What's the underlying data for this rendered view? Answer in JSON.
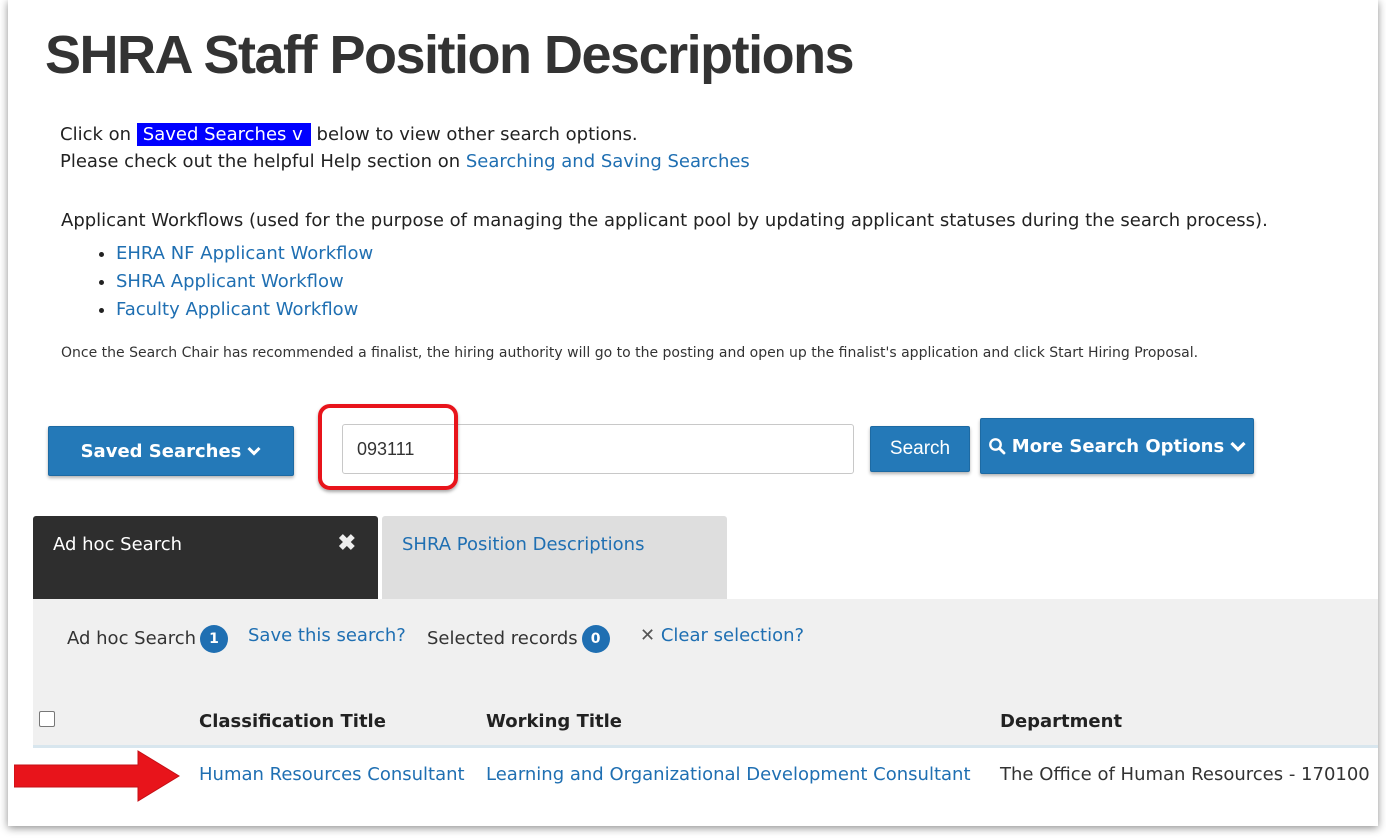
{
  "page_title": "SHRA Staff Position Descriptions",
  "instructions": {
    "click_on": "Click on",
    "saved_searches_highlight": "Saved Searches v",
    "below_text": "below to view other search options.",
    "help_text": "Please check out the helpful Help section on",
    "help_link": "Searching and Saving Searches"
  },
  "workflows": {
    "intro": "Applicant Workflows (used for the purpose of managing the applicant pool by updating applicant statuses during the search process).",
    "items": [
      "EHRA NF Applicant Workflow",
      "SHRA Applicant Workflow",
      "Faculty Applicant Workflow"
    ]
  },
  "note": "Once the Search Chair has recommended a finalist, the hiring authority will go to the posting and open up the finalist's application and click Start Hiring Proposal.",
  "search_bar": {
    "saved_searches_button": "Saved Searches",
    "query_value": "093111",
    "search_button": "Search",
    "more_options_button": "More Search Options"
  },
  "tabs": [
    {
      "label": "Ad hoc Search",
      "active": true
    },
    {
      "label": "SHRA Position Descriptions",
      "active": false
    }
  ],
  "toolbar": {
    "adhoc_label": "Ad hoc Search",
    "adhoc_count": "1",
    "save_link": "Save this search?",
    "selected_label": "Selected records",
    "selected_count": "0",
    "clear_link": "Clear selection?"
  },
  "table": {
    "columns": [
      "Classification Title",
      "Working Title",
      "Department"
    ],
    "rows": [
      [
        "Human Resources Consultant",
        "Learning and Organizational Development Consultant",
        "The Office of Human Resources - 170100"
      ]
    ]
  },
  "colors": {
    "button_blue": "#2479b8",
    "link_blue": "#1f6fb2",
    "highlight_blue": "#0000ff",
    "annotation_red": "#e8141b"
  }
}
